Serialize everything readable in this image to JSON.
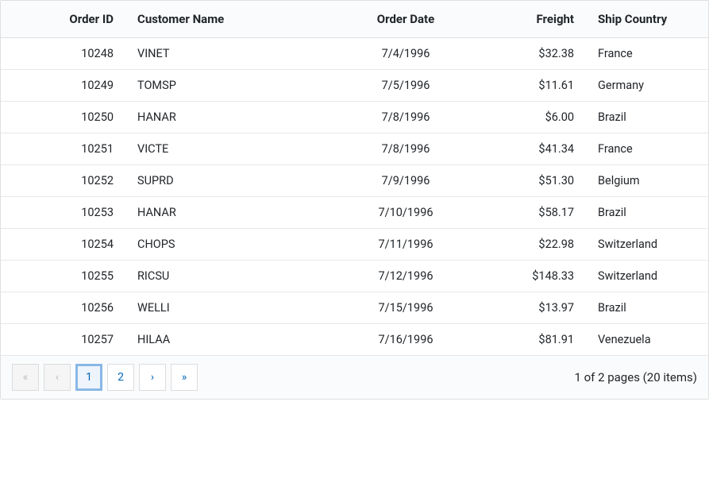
{
  "columns": {
    "order_id": "Order ID",
    "customer_name": "Customer Name",
    "order_date": "Order Date",
    "freight": "Freight",
    "ship_country": "Ship Country"
  },
  "rows": [
    {
      "order_id": "10248",
      "customer_name": "VINET",
      "order_date": "7/4/1996",
      "freight": "$32.38",
      "ship_country": "France"
    },
    {
      "order_id": "10249",
      "customer_name": "TOMSP",
      "order_date": "7/5/1996",
      "freight": "$11.61",
      "ship_country": "Germany"
    },
    {
      "order_id": "10250",
      "customer_name": "HANAR",
      "order_date": "7/8/1996",
      "freight": "$6.00",
      "ship_country": "Brazil"
    },
    {
      "order_id": "10251",
      "customer_name": "VICTE",
      "order_date": "7/8/1996",
      "freight": "$41.34",
      "ship_country": "France"
    },
    {
      "order_id": "10252",
      "customer_name": "SUPRD",
      "order_date": "7/9/1996",
      "freight": "$51.30",
      "ship_country": "Belgium"
    },
    {
      "order_id": "10253",
      "customer_name": "HANAR",
      "order_date": "7/10/1996",
      "freight": "$58.17",
      "ship_country": "Brazil"
    },
    {
      "order_id": "10254",
      "customer_name": "CHOPS",
      "order_date": "7/11/1996",
      "freight": "$22.98",
      "ship_country": "Switzerland"
    },
    {
      "order_id": "10255",
      "customer_name": "RICSU",
      "order_date": "7/12/1996",
      "freight": "$148.33",
      "ship_country": "Switzerland"
    },
    {
      "order_id": "10256",
      "customer_name": "WELLI",
      "order_date": "7/15/1996",
      "freight": "$13.97",
      "ship_country": "Brazil"
    },
    {
      "order_id": "10257",
      "customer_name": "HILAA",
      "order_date": "7/16/1996",
      "freight": "$81.91",
      "ship_country": "Venezuela"
    }
  ],
  "pager": {
    "first_glyph": "«",
    "prev_glyph": "‹",
    "next_glyph": "›",
    "last_glyph": "»",
    "pages": [
      "1",
      "2"
    ],
    "current_page_index": 0,
    "info": "1 of 2 pages (20 items)"
  }
}
